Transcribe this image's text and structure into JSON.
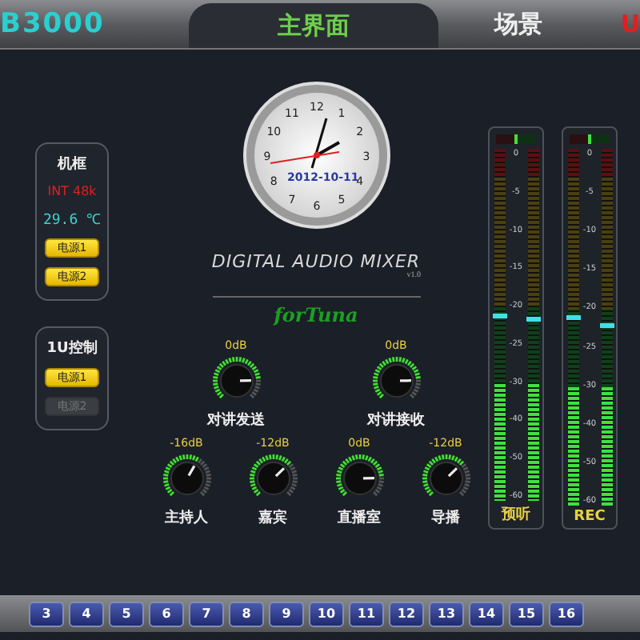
{
  "header": {
    "logo": "B3000",
    "tabs": [
      {
        "label": "主界面",
        "selected": true
      },
      {
        "label": "场景",
        "selected": false
      },
      {
        "label": "U",
        "selected": false,
        "kind": "alert"
      }
    ]
  },
  "frame_panel": {
    "title": "机框",
    "clock_source": "INT 48k",
    "temperature": "29.6 ℃",
    "power": [
      {
        "label": "电源1",
        "on": true
      },
      {
        "label": "电源2",
        "on": true
      }
    ]
  },
  "control_panel": {
    "title": "1U控制",
    "power": [
      {
        "label": "电源1",
        "on": true
      },
      {
        "label": "电源2",
        "on": false
      }
    ]
  },
  "clock": {
    "date": "2012-10-11",
    "numerals": [
      "1",
      "2",
      "3",
      "4",
      "5",
      "6",
      "7",
      "8",
      "9",
      "10",
      "11",
      "12"
    ]
  },
  "brand": {
    "title": "DIGITAL AUDIO MIXER",
    "version": "v1.0",
    "logo": "forTuna"
  },
  "intercom_knobs": [
    {
      "label": "对讲发送",
      "reading": "0dB"
    },
    {
      "label": "对讲接收",
      "reading": "0dB"
    }
  ],
  "channel_knobs": [
    {
      "label": "主持人",
      "reading": "-16dB"
    },
    {
      "label": "嘉宾",
      "reading": "-12dB"
    },
    {
      "label": "直播室",
      "reading": "0dB"
    },
    {
      "label": "导播",
      "reading": "-12dB"
    }
  ],
  "meters": [
    {
      "label": "预听",
      "scale": [
        "0",
        "-5",
        "-10",
        "-15",
        "-20",
        "-25",
        "-30",
        "-40",
        "-50",
        "-60"
      ],
      "channels": [
        {
          "level": 0.33,
          "peak": {
            "level": 0.52
          }
        },
        {
          "level": 0.33,
          "peak": {
            "level": 0.51
          }
        }
      ]
    },
    {
      "label": "REC",
      "scale": [
        "0",
        "-5",
        "-10",
        "-15",
        "-20",
        "-25",
        "-30",
        "-40",
        "-50",
        "-60"
      ],
      "channels": [
        {
          "level": 0.33,
          "peak": {
            "level": 0.52
          }
        },
        {
          "level": 0.33,
          "peak": {
            "level": 0.5
          }
        }
      ]
    }
  ],
  "scenes": [
    {
      "label": "3"
    },
    {
      "label": "4"
    },
    {
      "label": "5"
    },
    {
      "label": "6"
    },
    {
      "label": "7"
    },
    {
      "label": "8"
    },
    {
      "label": "9"
    },
    {
      "label": "10"
    },
    {
      "label": "11"
    },
    {
      "label": "12"
    },
    {
      "label": "13"
    },
    {
      "label": "14"
    },
    {
      "label": "15"
    },
    {
      "label": "16"
    }
  ]
}
